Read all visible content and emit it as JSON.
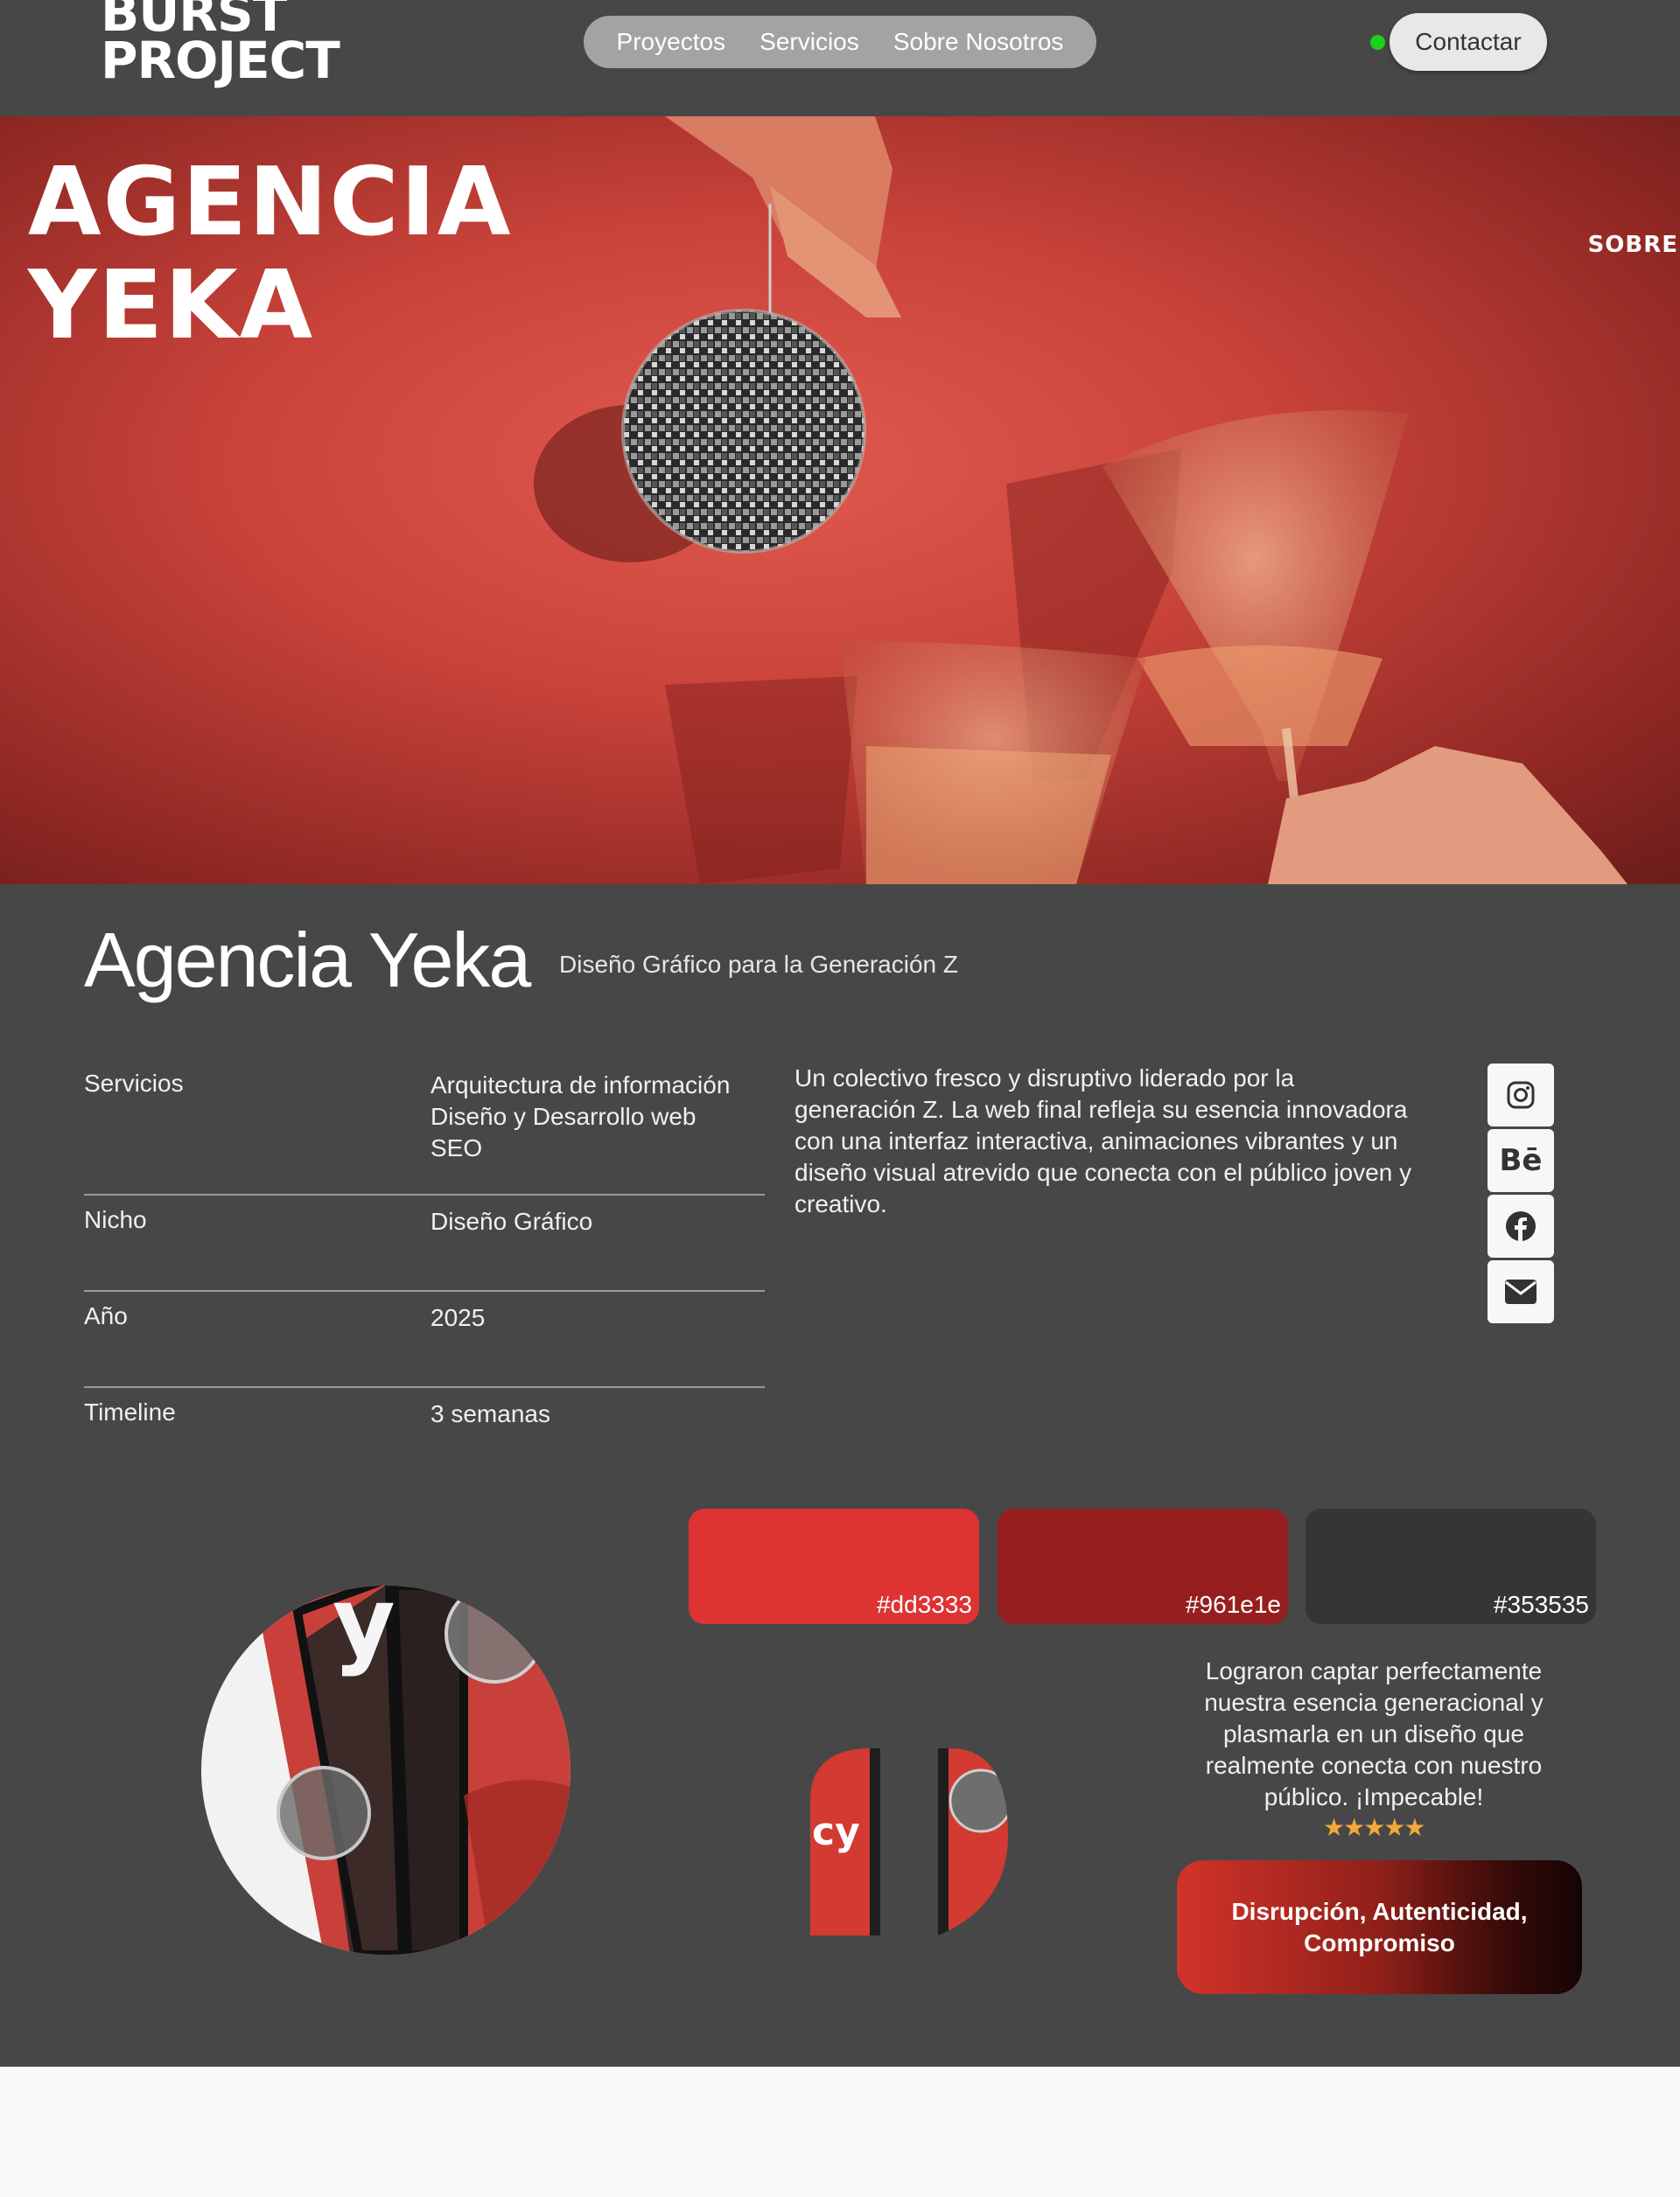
{
  "header": {
    "logo_line1": "BURST",
    "logo_line2": "PROJECT",
    "nav": [
      "Proyectos",
      "Servicios",
      "Sobre Nosotros"
    ],
    "contact_label": "Contactar",
    "status_color": "#19d219"
  },
  "hero": {
    "title_line1": "AGENCIA",
    "title_line2": "YEKA",
    "side_text": "SOBRE"
  },
  "project": {
    "title": "Agencia Yeka",
    "subtitle": "Diseño Gráfico para la Generación Z",
    "details": [
      {
        "label": "Servicios",
        "values": [
          "Arquitectura de información",
          "Diseño y Desarrollo web",
          "SEO"
        ]
      },
      {
        "label": "Nicho",
        "values": [
          "Diseño Gráfico"
        ]
      },
      {
        "label": "Año",
        "values": [
          "2025"
        ]
      },
      {
        "label": "Timeline",
        "values": [
          "3 semanas"
        ]
      }
    ],
    "description": "Un colectivo fresco y disruptivo liderado por la generación Z. La web final refleja su esencia innovadora con una interfaz interactiva, animaciones vibrantes y un diseño visual atrevido que conecta con el público joven y creativo.",
    "socials": [
      "instagram-icon",
      "behance-icon",
      "facebook-icon",
      "mail-icon"
    ],
    "behance_glyph": "Bē"
  },
  "palette": [
    {
      "hex": "#dd3333"
    },
    {
      "hex": "#961e1e"
    },
    {
      "hex": "#353535"
    }
  ],
  "review": {
    "text": "Lograron captar perfectamente nuestra esencia generacional y plasmarla en un diseño que realmente conecta con nuestro público. ¡Impecable!",
    "stars": "★★★★★",
    "rating": 5
  },
  "values_label": "Disrupción, Autenticidad, Compromiso",
  "mockup_text_large": "y",
  "mockup_text_small": "cy"
}
